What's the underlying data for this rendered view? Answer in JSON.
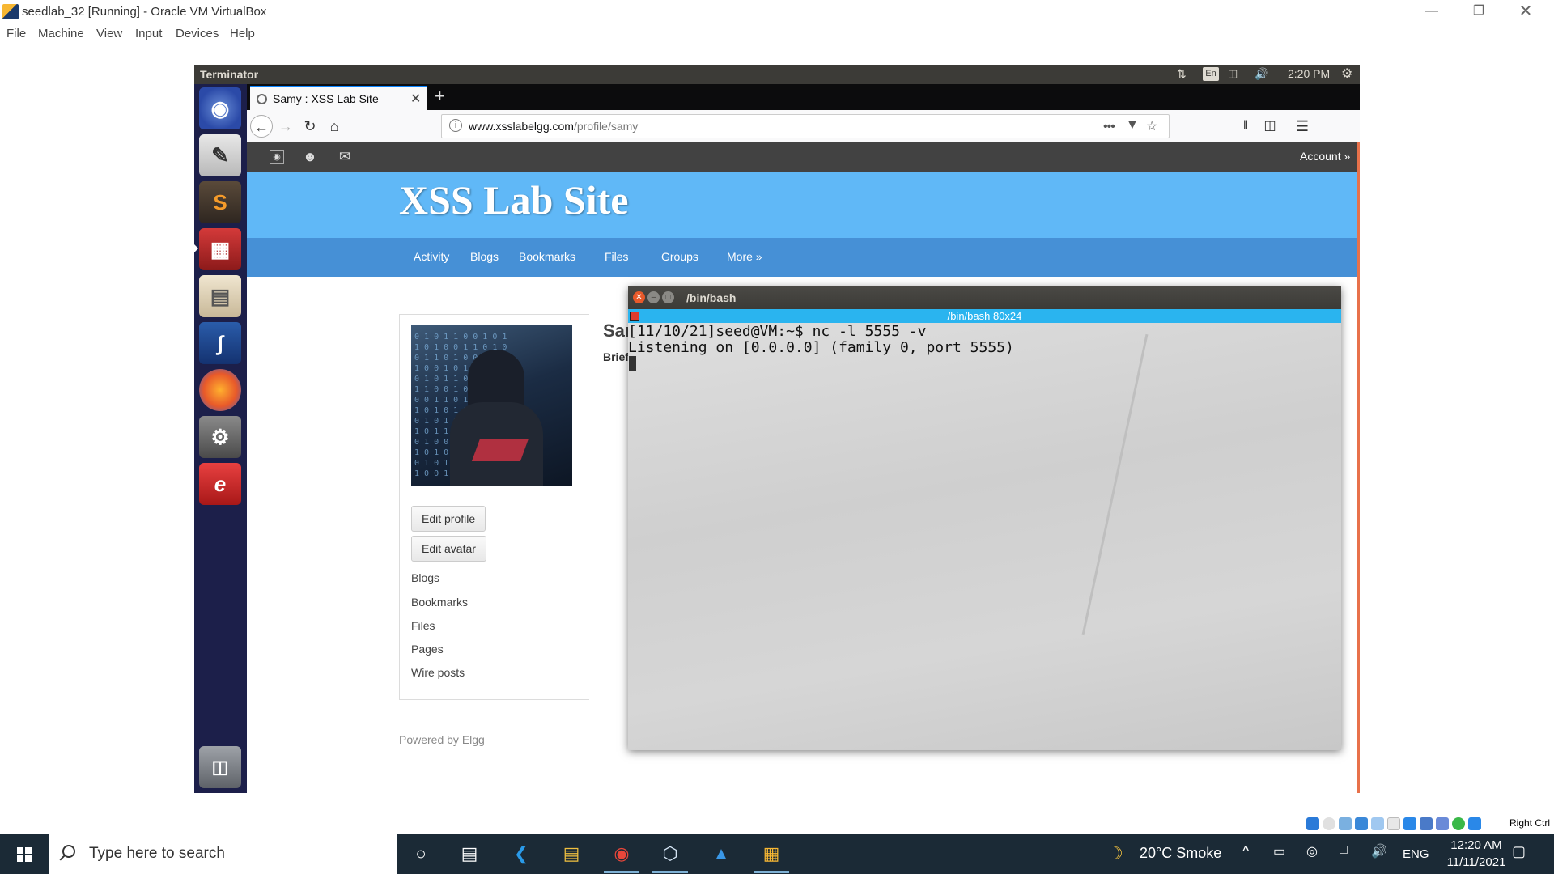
{
  "host": {
    "title": "seedlab_32 [Running] - Oracle VM VirtualBox",
    "menu": [
      "File",
      "Machine",
      "View",
      "Input",
      "Devices",
      "Help"
    ],
    "status_right": "Right Ctrl"
  },
  "guest": {
    "topbar": {
      "app_name": "Terminator",
      "lang": "En",
      "time": "2:20 PM"
    },
    "launcher_icons": [
      "ubuntu-dash-icon",
      "text-editor-icon",
      "sublime-text-icon",
      "terminator-icon",
      "files-icon",
      "wireshark-icon",
      "firefox-icon",
      "system-settings-icon",
      "text-reader-icon",
      "trash-icon"
    ]
  },
  "browser": {
    "tab_title": "Samy : XSS Lab Site",
    "url_domain": "www.xsslabelgg.com",
    "url_path": "/profile/samy",
    "url_dots": "•••"
  },
  "page": {
    "account_label": "Account »",
    "site_title": "XSS Lab Site",
    "menu": [
      "Activity",
      "Blogs",
      "Bookmarks",
      "Files",
      "Groups",
      "More »"
    ],
    "buttons": {
      "edit_profile": "Edit profile",
      "edit_avatar": "Edit avatar"
    },
    "owner_links": [
      "Blogs",
      "Bookmarks",
      "Files",
      "Pages",
      "Wire posts"
    ],
    "profile_name": "Sam",
    "brief_label": "Brief",
    "powered_by": "Powered by Elgg"
  },
  "terminal": {
    "title": "/bin/bash",
    "sub_title": "/bin/bash 80x24",
    "lines": [
      "[11/10/21]seed@VM:~$ nc -l 5555 -v",
      "Listening on [0.0.0.0] (family 0, port 5555)"
    ]
  },
  "taskbar": {
    "search_placeholder": "Type here to search",
    "weather": "20°C  Smoke",
    "lang": "ENG",
    "time": "12:20 AM",
    "date": "11/11/2021"
  }
}
